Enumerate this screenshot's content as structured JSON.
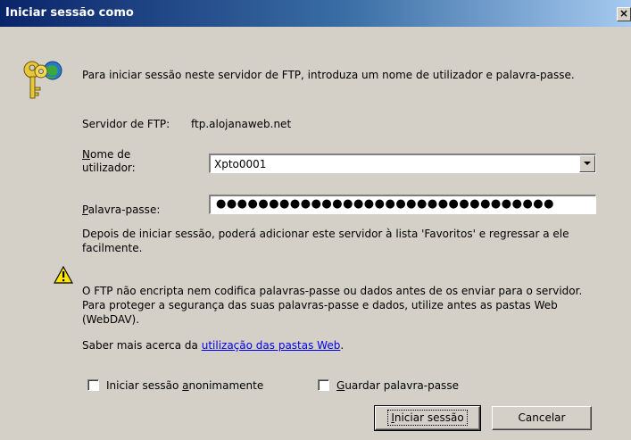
{
  "window": {
    "title": "Iniciar sessão como",
    "close_glyph": "×"
  },
  "icons": {
    "key": "keys-icon",
    "warning": "warning-icon"
  },
  "intro_text": "Para iniciar sessão neste servidor de FTP, introduza um nome de utilizador e palavra-passe.",
  "server": {
    "label": "Servidor de FTP:",
    "value": "ftp.alojanaweb.net"
  },
  "username": {
    "label_accel": "N",
    "label_rest_line1": "ome de",
    "label_line2": "utilizador:",
    "value": "Xpto0001"
  },
  "password": {
    "label_accel": "P",
    "label_rest": "alavra-passe:",
    "masked_value": "●●●●●●●●●●●●●●●●●●●●●●●●●●●●●●●●"
  },
  "after_login_text": "Depois de iniciar sessão, poderá adicionar este servidor à lista 'Favoritos' e regressar a ele facilmente.",
  "warning_text": "O FTP não encripta nem codifica  palavras-passe ou dados antes de os enviar para o servidor. Para proteger a segurança das suas palavras-passe e dados, utilize antes as pastas Web (WebDAV).",
  "learn_more": {
    "prefix": "Saber mais acerca da ",
    "link": "utilização das pastas Web",
    "suffix": "."
  },
  "options": {
    "anonymous": {
      "pre": "Iniciar sessão ",
      "accel": "a",
      "post": "nonimamente",
      "checked": false
    },
    "save_password": {
      "accel": "G",
      "post": "uardar palavra-passe",
      "checked": false
    }
  },
  "buttons": {
    "login": {
      "accel": "I",
      "rest": "niciar sessão"
    },
    "cancel": "Cancelar"
  },
  "colors": {
    "dialog_bg": "#d4d0c8",
    "title_start": "#0a246a",
    "title_end": "#a6caf0",
    "link": "#0000ee"
  }
}
